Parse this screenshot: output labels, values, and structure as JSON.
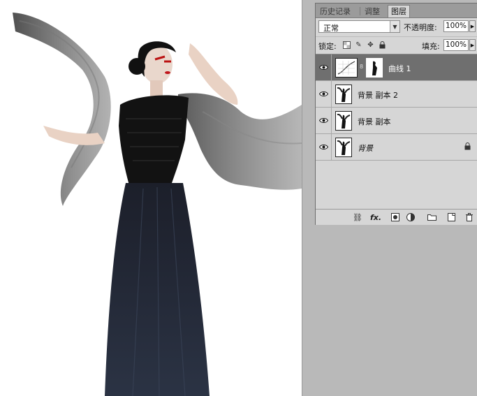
{
  "tabs": [
    {
      "label": "历史记录"
    },
    {
      "label": "调整"
    },
    {
      "label": "图层"
    }
  ],
  "blend_mode": {
    "value": "正常"
  },
  "opacity": {
    "label": "不透明度:",
    "value": "100%"
  },
  "lock": {
    "label": "锁定:"
  },
  "fill": {
    "label": "填充:",
    "value": "100%"
  },
  "layers": [
    {
      "name": "曲线 1",
      "selected": true,
      "type": "adjustment"
    },
    {
      "name": "背景 副本 2",
      "selected": false,
      "type": "image"
    },
    {
      "name": "背景 副本",
      "selected": false,
      "type": "image"
    },
    {
      "name": "背景",
      "selected": false,
      "type": "image",
      "locked": true
    }
  ],
  "bottom_icons": [
    "link-icon",
    "fx-icon",
    "mask-icon",
    "adjustment-icon",
    "group-folder-icon",
    "new-layer-icon",
    "trash-icon"
  ],
  "bottom_labels": {
    "fx": "fx."
  },
  "colors": {
    "panel_bg": "#d6d6d6",
    "selected_row": "#6f6f6f",
    "tab_bar": "#9b9b9b"
  }
}
